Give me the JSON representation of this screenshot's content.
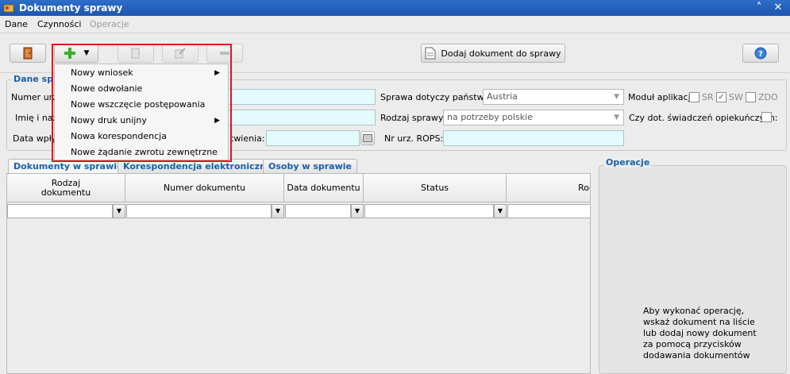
{
  "window": {
    "title": "Dokumenty sprawy"
  },
  "menubar": {
    "items": [
      "Dane",
      "Czynności",
      "Operacje"
    ]
  },
  "toolbar": {
    "add_document_label": "Dodaj dokument do sprawy"
  },
  "dropdown": {
    "items": [
      {
        "label": "Nowy wniosek",
        "submenu": true
      },
      {
        "label": "Nowe odwołanie",
        "submenu": false
      },
      {
        "label": "Nowe wszczęcie postępowania",
        "submenu": false
      },
      {
        "label": "Nowy druk unijny",
        "submenu": true
      },
      {
        "label": "Nowa korespondencja",
        "submenu": false
      },
      {
        "label": "Nowe żądanie zwrotu zewnętrzne",
        "submenu": false
      }
    ]
  },
  "case": {
    "section_title": "Dane spr",
    "number_label": "Numer urz",
    "name_label": "Imię i naz",
    "date_label": "Data wpły",
    "establish_label": "twienia:",
    "state_label": "Sprawa dotyczy państwa:",
    "state_value": "Austria",
    "type_label": "Rodzaj sprawy:",
    "type_value": "na potrzeby polskie",
    "rops_label": "Nr urz. ROPS:",
    "module_label": "Moduł aplikacji:",
    "module_options": [
      {
        "label": "SR",
        "checked": false
      },
      {
        "label": "SW",
        "checked": true
      },
      {
        "label": "ZDO",
        "checked": false
      }
    ],
    "care_label": "Czy dot. świadczeń opiekuńczych:"
  },
  "tabs": [
    "Dokumenty w sprawie",
    "Korespondencja elektroniczna",
    "Osoby w sprawie"
  ],
  "grid": {
    "columns": [
      "Rodzaj\ndokumentu",
      "Numer dokumentu",
      "Data dokumentu",
      "Status",
      "Rod"
    ]
  },
  "operations": {
    "title": "Operacje",
    "hint": "Aby wykonać operację,\nwskaż dokument na liście\nlub dodaj nowy dokument\nza pomocą przycisków\ndodawania dokumentów"
  }
}
